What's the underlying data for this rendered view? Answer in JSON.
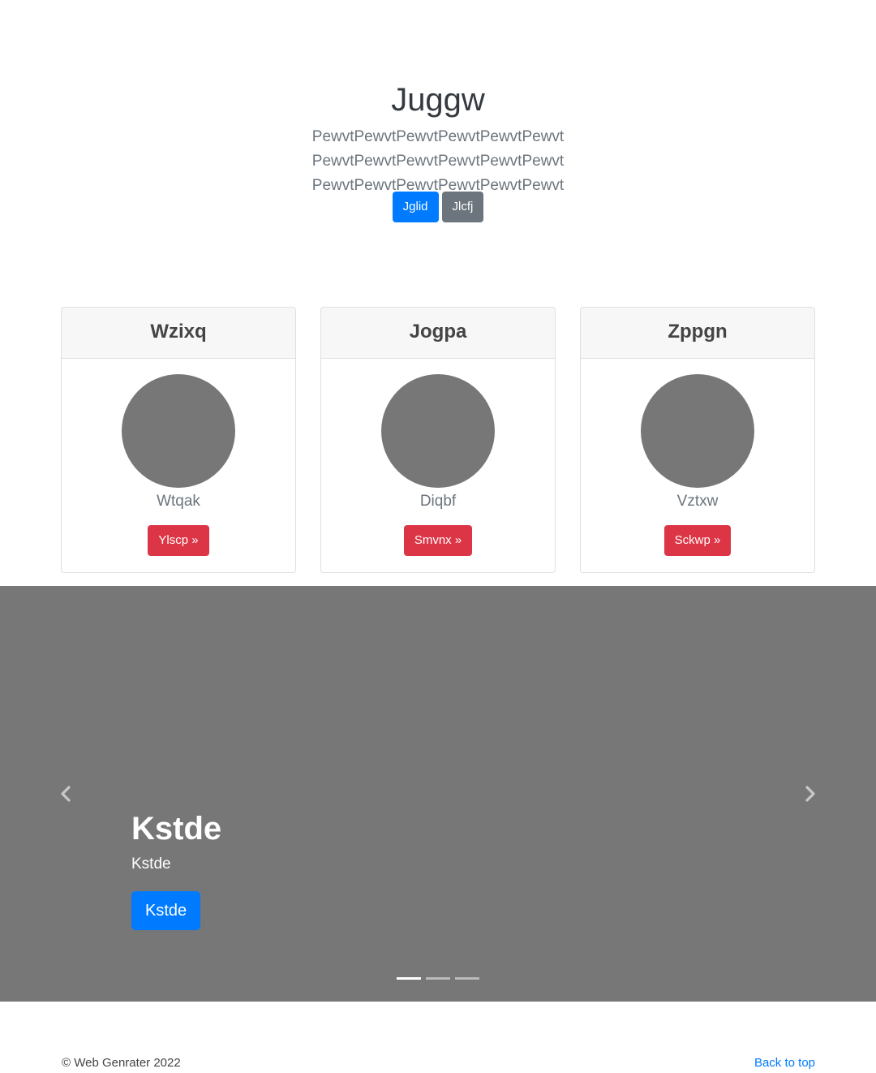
{
  "hero": {
    "title": "Juggw",
    "lead": "PewvtPewvtPewvtPewvtPewvtPewvt PewvtPewvtPewvtPewvtPewvtPewvt PewvtPewvtPewvtPewvtPewvtPewvt",
    "primary_button": "Jglid",
    "secondary_button": "Jlcfj"
  },
  "cards": [
    {
      "header": "Wzixq",
      "name": "Wtqak",
      "button": "Ylscp »"
    },
    {
      "header": "Jogpa",
      "name": "Diqbf",
      "button": "Smvnx »"
    },
    {
      "header": "Zppgn",
      "name": "Vztxw",
      "button": "Sckwp »"
    }
  ],
  "carousel": {
    "caption_title": "Kstde",
    "caption_text": "Kstde",
    "caption_button": "Kstde",
    "slide_count": 3,
    "active_index": 0
  },
  "footer": {
    "copyright": "© Web Genrater 2022",
    "back_to_top": "Back to top"
  },
  "colors": {
    "primary": "#007bff",
    "secondary": "#6c757d",
    "danger": "#dc3545",
    "placeholder_gray": "#777777"
  }
}
